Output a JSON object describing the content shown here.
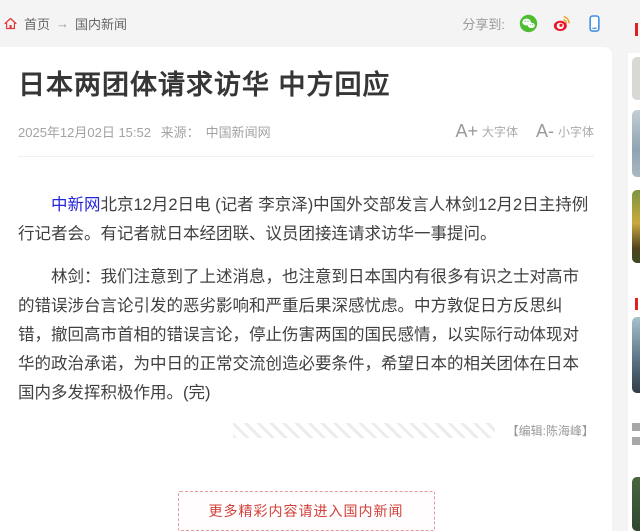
{
  "page": {
    "colors": {
      "page_bg": "#f4f4f5",
      "card_bg": "#ffffff",
      "accent_red": "#d2413c",
      "link_blue": "#2626d9",
      "wechat_green": "#4dbe2f",
      "weibo_red": "#e6162d",
      "mobile_blue": "#3f8fe8"
    },
    "icons": {
      "breadcrumb_home": "home-icon",
      "share_1": "wechat-icon",
      "share_2": "weibo-icon",
      "share_3": "mobile-icon"
    }
  },
  "breadcrumb": {
    "home": "首页",
    "separator": "→",
    "current": "国内新闻"
  },
  "share": {
    "label": "分享到:"
  },
  "article": {
    "title": "日本两团体请求访华 中方回应",
    "datetime": "2025年12月02日 15:52",
    "source_label": "来源：",
    "source_name": "中国新闻网",
    "font_size_controls": {
      "larger_symbol": "A+",
      "larger_label": "大字体",
      "smaller_symbol": "A-",
      "smaller_label": "小字体"
    },
    "paragraphs": [
      {
        "link_text": "中新网",
        "text": "北京12月2日电 (记者 李京泽)中国外交部发言人林剑12月2日主持例行记者会。有记者就日本经团联、议员团接连请求访华一事提问。"
      },
      {
        "link_text": "",
        "text": "林剑：我们注意到了上述消息，也注意到日本国内有很多有识之士对高市的错误涉台言论引发的恶劣影响和严重后果深感忧虑。中方敦促日方反思纠错，撤回高市首相的错误言论，停止伤害两国的国民感情，以实际行动体现对华的政治承诺，为中日的正常交流创造必要条件，希望日本的相关团体在日本国内多发挥积极作用。(完)"
      }
    ],
    "editor_credit": "【编辑:陈海峰】"
  },
  "footer": {
    "more_link": "更多精彩内容请进入国内新闻"
  }
}
